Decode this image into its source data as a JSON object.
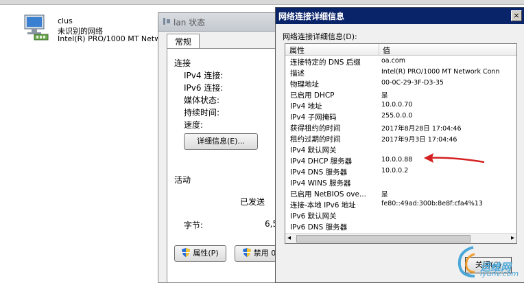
{
  "adapter": {
    "name": "clus",
    "status": "未识别的网络",
    "device": "Intel(R) PRO/1000 MT Netw"
  },
  "lan_window": {
    "title": "lan 状态",
    "tab": "常规",
    "connection_header": "连接",
    "fields": [
      "IPv4 连接:",
      "IPv6 连接:",
      "媒体状态:",
      "持续时间:",
      "速度:"
    ],
    "details_button": "详细信息(E)...",
    "activity_header": "活动",
    "sent_label": "已发送",
    "bytes_label": "字节:",
    "bytes_value": "6,5",
    "properties_button": "属性(P)",
    "disable_button": "禁用 0"
  },
  "details_window": {
    "title": "网络连接详细信息",
    "close_x": "×",
    "label": "网络连接详细信息(D):",
    "columns": [
      "属性",
      "值"
    ],
    "rows": [
      {
        "property": "连接特定的 DNS 后缀",
        "value": "oa.com"
      },
      {
        "property": "描述",
        "value": "Intel(R) PRO/1000 MT Network Conn"
      },
      {
        "property": "物理地址",
        "value": "00-0C-29-3F-D3-35"
      },
      {
        "property": "已启用 DHCP",
        "value": "是"
      },
      {
        "property": "IPv4 地址",
        "value": "10.0.0.70"
      },
      {
        "property": "IPv4 子网掩码",
        "value": "255.0.0.0"
      },
      {
        "property": "获得租约的时间",
        "value": "2017年8月28日 17:04:46"
      },
      {
        "property": "租约过期的时间",
        "value": "2017年9月3日 17:04:46"
      },
      {
        "property": "IPv4 默认网关",
        "value": ""
      },
      {
        "property": "IPv4 DHCP 服务器",
        "value": "10.0.0.88"
      },
      {
        "property": "IPv4 DNS 服务器",
        "value": "10.0.0.2"
      },
      {
        "property": "IPv4 WINS 服务器",
        "value": ""
      },
      {
        "property": "已启用 NetBIOS ove...",
        "value": "是"
      },
      {
        "property": "连接-本地 IPv6 地址",
        "value": "fe80::49ad:300b:8e8f:cfa4%13"
      },
      {
        "property": "IPv6 默认网关",
        "value": ""
      },
      {
        "property": "IPv6 DNS 服务器",
        "value": ""
      }
    ],
    "scroll_left": "◂",
    "scroll_right": "▸",
    "close_button": "关闭(C)"
  },
  "watermark": {
    "line1": "运维网",
    "line2": "iyunv.com"
  },
  "colors": {
    "title_bar": "#0a246a",
    "arrow": "#d42020",
    "watermark": "#4aa7d8"
  }
}
